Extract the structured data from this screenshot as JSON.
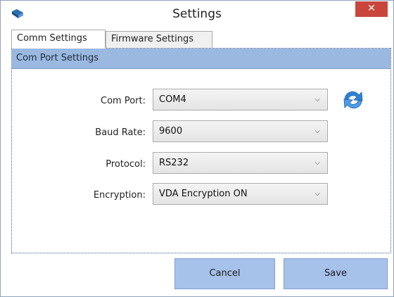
{
  "window": {
    "title": "Settings",
    "close_glyph": "✕"
  },
  "tabs": [
    {
      "label": "Comm Settings",
      "active": true
    },
    {
      "label": "Firmware Settings",
      "active": false
    }
  ],
  "panel": {
    "header": "Com Port Settings",
    "fields": [
      {
        "label": "Com Port:",
        "value": "COM4"
      },
      {
        "label": "Baud Rate:",
        "value": "9600"
      },
      {
        "label": "Protocol:",
        "value": "RS232"
      },
      {
        "label": "Encryption:",
        "value": "VDA Encryption ON"
      }
    ],
    "refresh_icon": "refresh-icon"
  },
  "buttons": {
    "cancel": "Cancel",
    "save": "Save"
  },
  "colors": {
    "close": "#c9463d",
    "panel_header": "#9ab8e0",
    "button": "#a6c1ea",
    "refresh": "#2f83d6"
  }
}
